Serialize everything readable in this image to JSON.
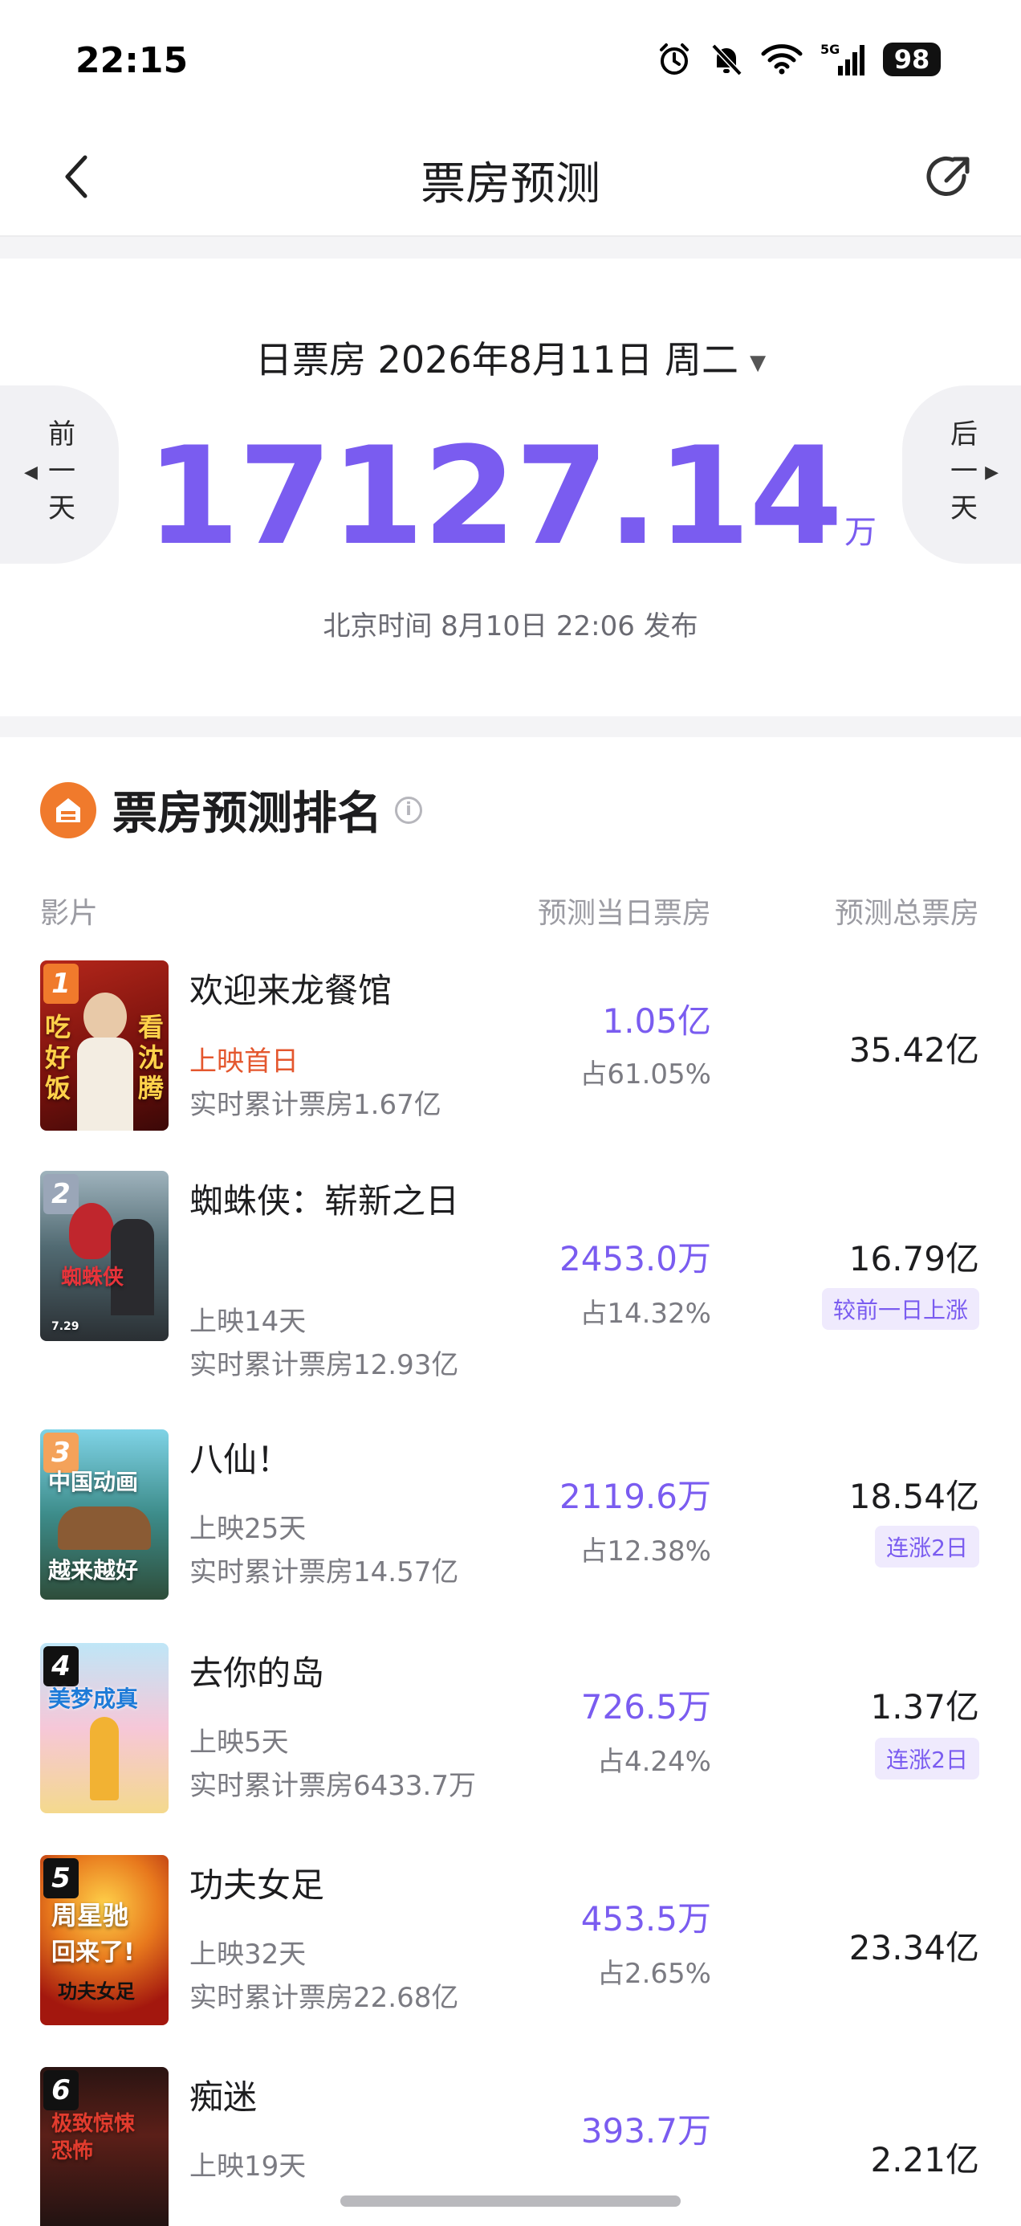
{
  "status_bar": {
    "time": "22:15",
    "network": "5G",
    "battery": "98",
    "icons": [
      "alarm-icon",
      "mute-icon",
      "wifi-icon",
      "signal-icon",
      "battery-icon"
    ]
  },
  "nav": {
    "title": "票房预测",
    "back_icon": "chevron-left-icon",
    "share_icon": "share-icon"
  },
  "header": {
    "date_label": "日票房 2026年8月11日 周二",
    "prev_day": "前一天",
    "next_day": "后一天",
    "total_value": "17127.14",
    "total_unit": "万",
    "publish_time": "北京时间 8月10日 22:06 发布"
  },
  "ranking": {
    "title": "票房预测排名",
    "columns": {
      "film": "影片",
      "day": "预测当日票房",
      "total": "预测总票房"
    },
    "items": [
      {
        "rank": "1",
        "title": "欢迎来龙餐馆",
        "status": "上映首日",
        "cumulative": "实时累计票房1.67亿",
        "day_box": "1.05亿",
        "share": "占61.05%",
        "total": "35.42亿",
        "tag": "",
        "poster_texts": [
          "吃",
          "好",
          "饭",
          "看",
          "沈",
          "腾"
        ]
      },
      {
        "rank": "2",
        "title": "蜘蛛侠：崭新之日",
        "status": "上映14天",
        "cumulative": "实时累计票房12.93亿",
        "day_box": "2453.0万",
        "share": "占14.32%",
        "total": "16.79亿",
        "tag": "较前一日上涨",
        "poster_texts": [
          "蜘蛛侠",
          "7.29"
        ]
      },
      {
        "rank": "3",
        "title": "八仙！",
        "status": "上映25天",
        "cumulative": "实时累计票房14.57亿",
        "day_box": "2119.6万",
        "share": "占12.38%",
        "total": "18.54亿",
        "tag": "连涨2日",
        "poster_texts": [
          "中国动画",
          "越来越好"
        ]
      },
      {
        "rank": "4",
        "title": "去你的岛",
        "status": "上映5天",
        "cumulative": "实时累计票房6433.7万",
        "day_box": "726.5万",
        "share": "占4.24%",
        "total": "1.37亿",
        "tag": "连涨2日",
        "poster_texts": [
          "美梦成真"
        ]
      },
      {
        "rank": "5",
        "title": "功夫女足",
        "status": "上映32天",
        "cumulative": "实时累计票房22.68亿",
        "day_box": "453.5万",
        "share": "占2.65%",
        "total": "23.34亿",
        "tag": "",
        "poster_texts": [
          "周星驰",
          "回来了!",
          "功夫女足"
        ]
      },
      {
        "rank": "6",
        "title": "痴迷",
        "status": "上映19天",
        "cumulative": "",
        "day_box": "393.7万",
        "share": "",
        "total": "2.21亿",
        "tag": "",
        "poster_texts": [
          "极致惊悚",
          "恐怖"
        ]
      }
    ]
  },
  "colors": {
    "accent_purple": "#7a5cf0",
    "hot_orange": "#e4572e",
    "section_icon_orange": "#f07a2c"
  }
}
